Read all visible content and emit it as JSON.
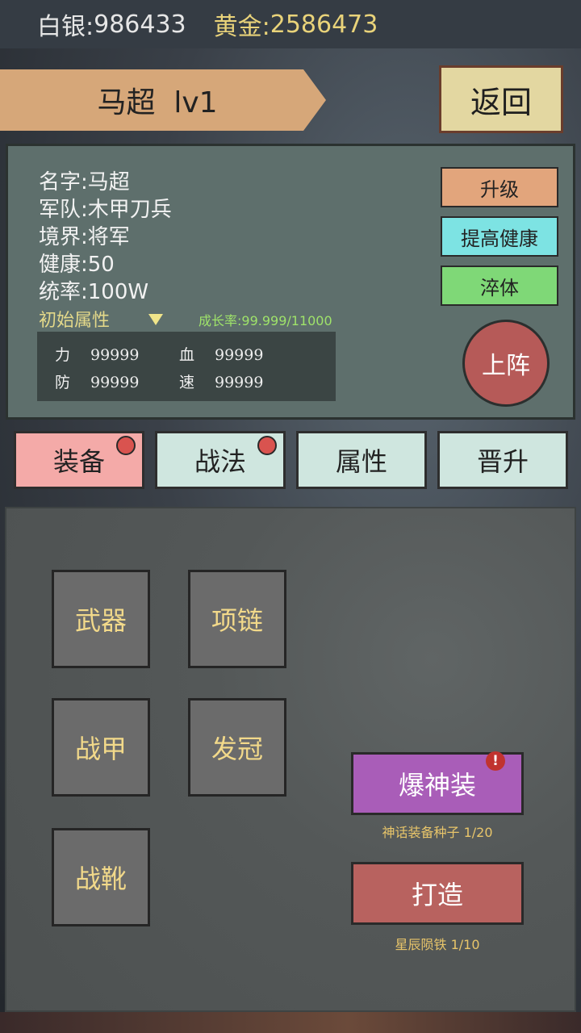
{
  "currency": {
    "silver_label": "白银:",
    "silver_value": "986433",
    "gold_label": "黄金:",
    "gold_value": "2586473"
  },
  "header": {
    "hero_title": "马超  lv1",
    "back_label": "返回"
  },
  "hero_info": {
    "name": "名字:马超",
    "army": "军队:木甲刀兵",
    "realm": "境界:将军",
    "health": "健康:50",
    "command": "统率:100W",
    "initial_attr_label": "初始属性",
    "growth_rate": "成长率:99.999/11000",
    "stats": [
      {
        "key": "力",
        "value": "99999"
      },
      {
        "key": "血",
        "value": "99999"
      },
      {
        "key": "防",
        "value": "99999"
      },
      {
        "key": "速",
        "value": "99999"
      }
    ]
  },
  "side_actions": {
    "upgrade": "升级",
    "improve_health": "提高健康",
    "temper": "淬体",
    "deploy": "上阵"
  },
  "tabs": [
    {
      "label": "装备",
      "active": true,
      "has_dot": true
    },
    {
      "label": "战法",
      "active": false,
      "has_dot": true
    },
    {
      "label": "属性",
      "active": false,
      "has_dot": false
    },
    {
      "label": "晋升",
      "active": false,
      "has_dot": false
    }
  ],
  "equipment_slots": {
    "weapon": "武器",
    "necklace": "项链",
    "armor": "战甲",
    "crown": "发冠",
    "boots": "战靴"
  },
  "actions": {
    "divine_gear": "爆神装",
    "divine_gear_caption": "神话装备种子 1/20",
    "forge": "打造",
    "forge_caption": "星辰陨铁 1/10",
    "alert_glyph": "!"
  },
  "colors": {
    "ribbon": "#d6a779",
    "back_button": "#e3d7a1",
    "upgrade": "#e2a57c",
    "improve_health": "#7de3e3",
    "temper": "#7fd877",
    "deploy": "#b65a58",
    "tab_active": "#f4aaa8",
    "tab_inactive": "#cfe6df",
    "divine_gear": "#a95db8",
    "forge": "#b8625f",
    "slot_text": "#f2d98a"
  }
}
